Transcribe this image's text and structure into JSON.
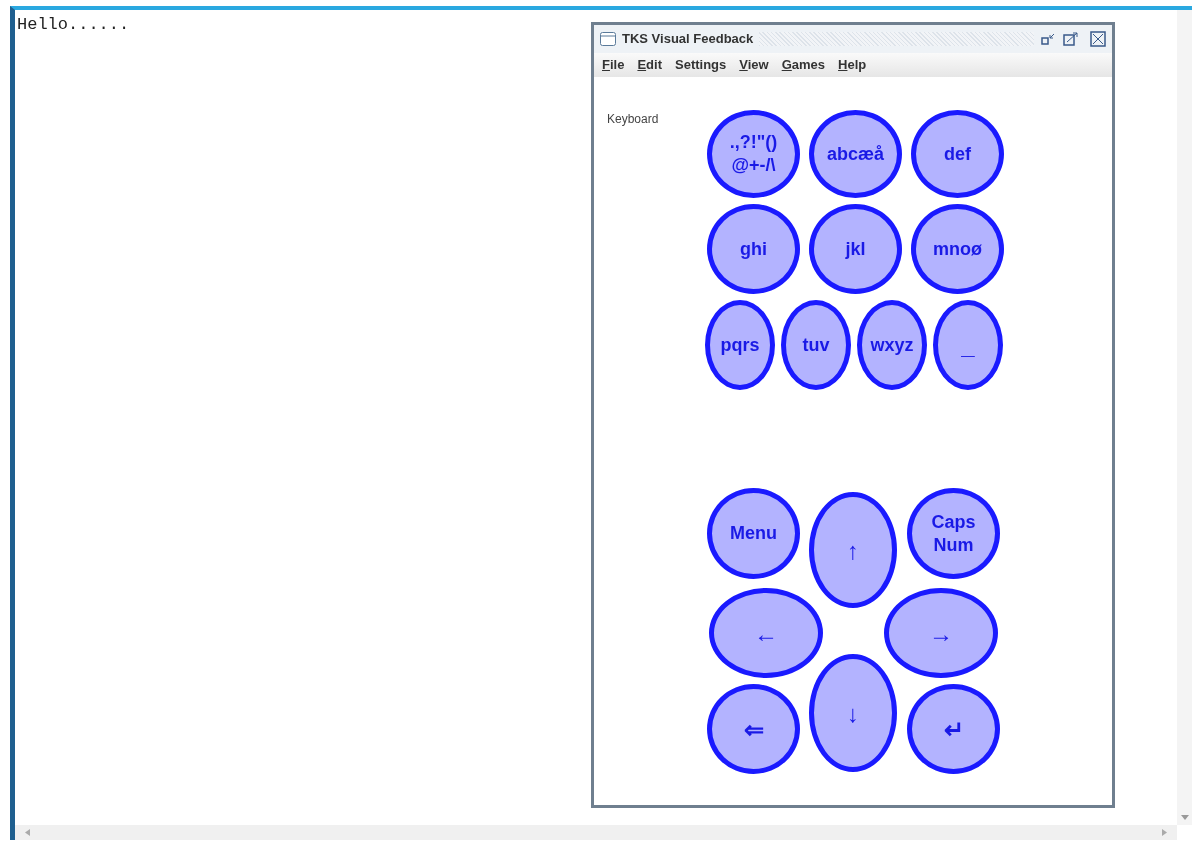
{
  "editor": {
    "text": "Hello......"
  },
  "window": {
    "title": "TKS Visual Feedback",
    "menu": [
      {
        "label": "File",
        "mnemonic_underlined": true
      },
      {
        "label": "Edit",
        "mnemonic_underlined": true
      },
      {
        "label": "Settings",
        "mnemonic_underlined": false
      },
      {
        "label": "View",
        "mnemonic_underlined": true
      },
      {
        "label": "Games",
        "mnemonic_underlined": true
      },
      {
        "label": "Help",
        "mnemonic_underlined": true
      }
    ],
    "panel_label": "Keyboard",
    "key_rows": [
      [
        {
          "lines": [
            ".,?!\"()",
            "@+-/\\"
          ]
        },
        {
          "lines": [
            "abcæå"
          ]
        },
        {
          "lines": [
            "def"
          ]
        }
      ],
      [
        {
          "lines": [
            "ghi"
          ]
        },
        {
          "lines": [
            "jkl"
          ]
        },
        {
          "lines": [
            "mnoø"
          ]
        }
      ],
      [
        {
          "lines": [
            "pqrs"
          ]
        },
        {
          "lines": [
            "tuv"
          ]
        },
        {
          "lines": [
            "wxyz"
          ]
        },
        {
          "lines": [
            "_"
          ]
        }
      ]
    ],
    "nav_keys": [
      {
        "lines": [
          "Menu"
        ]
      },
      {
        "lines": [
          "↑"
        ]
      },
      {
        "lines": [
          "Caps",
          "Num"
        ]
      },
      {
        "lines": [
          "←"
        ]
      },
      {
        "lines": [
          "→"
        ]
      },
      {
        "lines": [
          "⇐"
        ]
      },
      {
        "lines": [
          "↓"
        ]
      },
      {
        "lines": [
          "↵"
        ]
      }
    ]
  }
}
